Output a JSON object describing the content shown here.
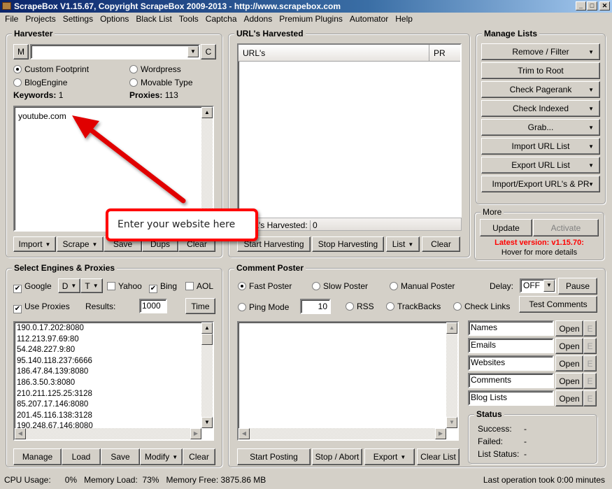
{
  "window": {
    "title": "ScrapeBox V1.15.67, Copyright ScrapeBox 2009-2013 - http://www.scrapebox.com",
    "controls": [
      "_",
      "□",
      "✕"
    ]
  },
  "menu": [
    "File",
    "Projects",
    "Settings",
    "Options",
    "Black List",
    "Tools",
    "Captcha",
    "Addons",
    "Premium Plugins",
    "Automator",
    "Help"
  ],
  "harvester": {
    "title": "Harvester",
    "m_label": "M",
    "c_label": "C",
    "footprint_value": "",
    "radios": [
      {
        "label": "Custom Footprint",
        "checked": true
      },
      {
        "label": "Wordpress",
        "checked": false
      },
      {
        "label": "BlogEngine",
        "checked": false
      },
      {
        "label": "Movable Type",
        "checked": false
      }
    ],
    "keywords_label": "Keywords:",
    "keywords_count": "1",
    "proxies_label": "Proxies:",
    "proxies_count": "113",
    "keywords_text": "youtube.com",
    "buttons": [
      "Import",
      "Scrape",
      "Save",
      "Dups",
      "Clear"
    ]
  },
  "callout": {
    "text": "Enter your website here",
    "color": "#ff0000"
  },
  "urls": {
    "title": "URL's Harvested",
    "col_url": "URL's",
    "col_pr": "PR",
    "status_label": "URL's Harvested:",
    "status_value": "0",
    "buttons": [
      "Start Harvesting",
      "Stop Harvesting",
      "List",
      "Clear"
    ]
  },
  "manage": {
    "title": "Manage Lists",
    "buttons": [
      {
        "label": "Remove / Filter",
        "dd": true
      },
      {
        "label": "Trim to Root",
        "dd": false
      },
      {
        "label": "Check Pagerank",
        "dd": true
      },
      {
        "label": "Check Indexed",
        "dd": true
      },
      {
        "label": "Grab...",
        "dd": true
      },
      {
        "label": "Import URL List",
        "dd": true
      },
      {
        "label": "Export URL List",
        "dd": true
      },
      {
        "label": "Import/Export URL's & PR",
        "dd": true
      }
    ]
  },
  "more": {
    "title": "More",
    "update": "Update",
    "activate": "Activate",
    "latest": "Latest version: v1.15.70:",
    "hover": "Hover for more details",
    "latest_color": "#ff0000"
  },
  "engines": {
    "title": "Select Engines & Proxies",
    "google": "Google",
    "google_checked": true,
    "d": "D",
    "t": "T",
    "yahoo": "Yahoo",
    "yahoo_checked": false,
    "bing": "Bing",
    "bing_checked": true,
    "aol": "AOL",
    "aol_checked": false,
    "use_proxies": "Use Proxies",
    "use_proxies_checked": true,
    "results_label": "Results:",
    "results_value": "1000",
    "time": "Time",
    "proxies": [
      "190.0.17.202:8080",
      "112.213.97.69:80",
      "54.248.227.9:80",
      "95.140.118.237:6666",
      "186.47.84.139:8080",
      "186.3.50.3:8080",
      "210.211.125.25:3128",
      "85.207.17.146:8080",
      "201.45.116.138:3128",
      "190.248.67.146:8080"
    ],
    "buttons": [
      "Manage",
      "Load",
      "Save",
      "Modify",
      "Clear"
    ]
  },
  "poster": {
    "title": "Comment Poster",
    "radios": [
      {
        "label": "Fast Poster",
        "checked": true
      },
      {
        "label": "Slow Poster",
        "checked": false
      },
      {
        "label": "Manual Poster",
        "checked": false
      },
      {
        "label": "Ping Mode",
        "checked": false
      },
      {
        "label": "RSS",
        "checked": false
      },
      {
        "label": "TrackBacks",
        "checked": false
      },
      {
        "label": "Check Links",
        "checked": false
      }
    ],
    "ping_value": "10",
    "delay_label": "Delay:",
    "delay_value": "OFF",
    "pause": "Pause",
    "test": "Test Comments",
    "files": [
      {
        "name": "Names",
        "open": "Open",
        "e": "E"
      },
      {
        "name": "Emails",
        "open": "Open",
        "e": "E"
      },
      {
        "name": "Websites",
        "open": "Open",
        "e": "E"
      },
      {
        "name": "Comments",
        "open": "Open",
        "e": "E"
      },
      {
        "name": "Blog Lists",
        "open": "Open",
        "e": "E"
      }
    ],
    "status_title": "Status",
    "success_label": "Success:",
    "success": "-",
    "failed_label": "Failed:",
    "failed": "-",
    "list_status_label": "List Status:",
    "list_status": "-",
    "buttons": [
      "Start Posting",
      "Stop / Abort",
      "Export",
      "Clear List"
    ]
  },
  "statusbar": {
    "cpu_label": "CPU Usage:",
    "cpu": "0%",
    "mem_load_label": "Memory Load:",
    "mem_load": "73%",
    "mem_free_label": "Memory Free:",
    "mem_free": "3875.86 MB",
    "last_op": "Last operation took 0:00 minutes"
  }
}
